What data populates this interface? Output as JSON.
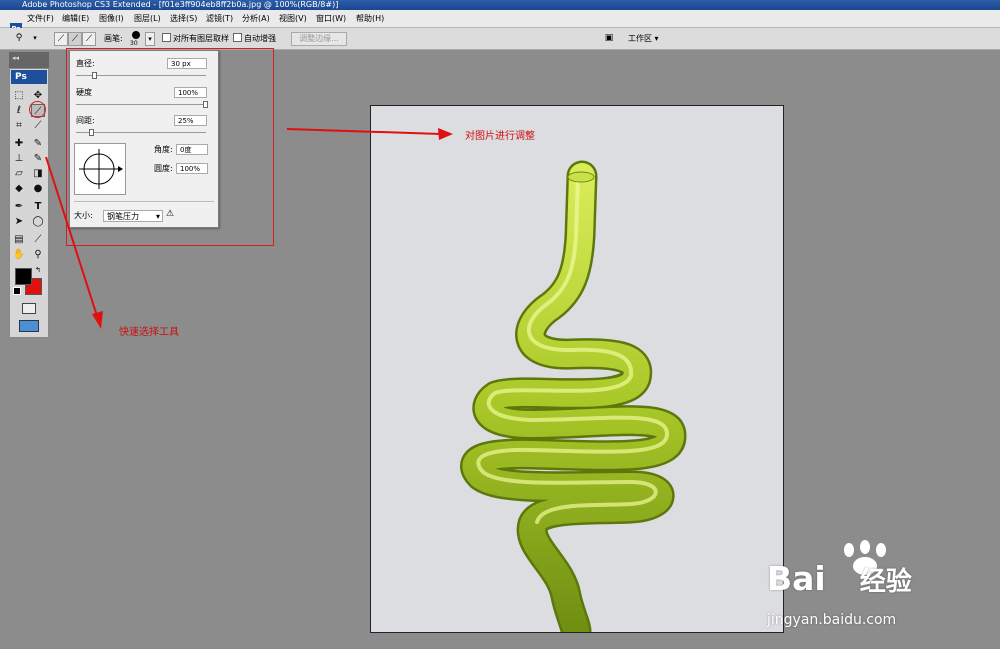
{
  "window": {
    "title": "Adobe Photoshop CS3 Extended - [f01e3ff904eb8ff2b0a.jpg @ 100%(RGB/8#)]"
  },
  "menubar": {
    "app_icon": "Ps",
    "items": [
      {
        "label": "文件(F)"
      },
      {
        "label": "编辑(E)"
      },
      {
        "label": "图像(I)"
      },
      {
        "label": "图层(L)"
      },
      {
        "label": "选择(S)"
      },
      {
        "label": "滤镜(T)"
      },
      {
        "label": "分析(A)"
      },
      {
        "label": "视图(V)"
      },
      {
        "label": "窗口(W)"
      },
      {
        "label": "帮助(H)"
      }
    ]
  },
  "options_bar": {
    "brush_label": "画笔:",
    "brush_size": "30",
    "sample_all_layers": "对所有图层取样",
    "auto_enhance": "自动增强",
    "refine_edge": "调整边缘...",
    "workspace": "工作区"
  },
  "toolbox": {
    "logo": "Ps"
  },
  "brush_panel": {
    "diameter_label": "直径:",
    "diameter_value": "30 px",
    "hardness_label": "硬度",
    "hardness_value": "100%",
    "spacing_label": "间距:",
    "spacing_value": "25%",
    "angle_label": "角度:",
    "angle_value": "0度",
    "roundness_label": "圆度:",
    "roundness_value": "100%",
    "size_label": "大小:",
    "size_value": "钢笔压力"
  },
  "annotations": {
    "adjust_image": "对图片进行调整",
    "quick_select": "快速选择工具"
  },
  "watermark": {
    "brand": "Bai",
    "brand_suffix": "经验",
    "url": "jingyan.baidu.com"
  },
  "colors": {
    "annotation": "#cc1010",
    "foreground": "#000000",
    "background": "#e11010",
    "snake": "#a8c828"
  },
  "icons": [
    "app-icon",
    "marquee-icon",
    "move-icon",
    "lasso-icon",
    "quick-selection-icon",
    "crop-icon",
    "slice-icon",
    "healing-icon",
    "brush-icon",
    "stamp-icon",
    "history-brush-icon",
    "eraser-icon",
    "gradient-icon",
    "blur-icon",
    "dodge-icon",
    "pen-icon",
    "type-icon",
    "path-selection-icon",
    "shape-icon",
    "notes-icon",
    "eyedropper-icon",
    "hand-icon",
    "zoom-icon",
    "warning-icon",
    "dropdown-arrow-icon"
  ]
}
